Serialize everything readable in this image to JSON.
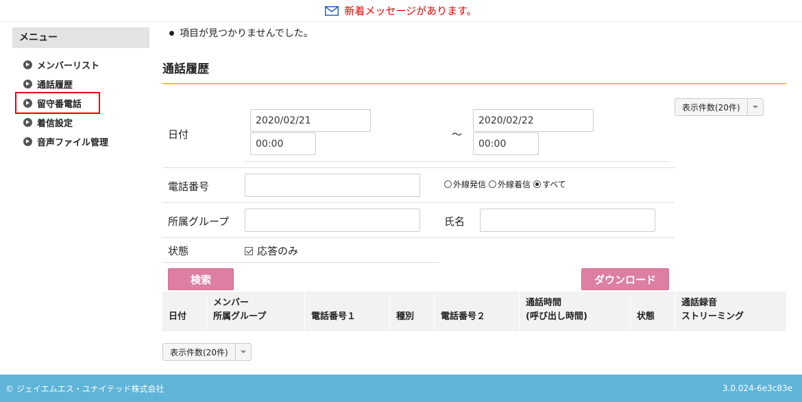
{
  "notice": {
    "text": "新着メッセージがあります。",
    "icon": "mail-icon"
  },
  "sidebar": {
    "header": "メニュー",
    "items": [
      {
        "label": "メンバーリスト"
      },
      {
        "label": "通話履歴"
      },
      {
        "label": "留守番電話"
      },
      {
        "label": "着信設定"
      },
      {
        "label": "音声ファイル管理"
      }
    ]
  },
  "main": {
    "no_items_message": "項目が見つかりませんでした。",
    "title": "通話履歴",
    "page_size_label": "表示件数(20件)",
    "form": {
      "date_label": "日付",
      "date_from": "2020/02/21",
      "time_from": "00:00",
      "range_separator": "～",
      "date_to": "2020/02/22",
      "time_to": "00:00",
      "phone_label": "電話番号",
      "phone_value": "",
      "radio_outgoing": "外線発信",
      "radio_incoming": "外線着信",
      "radio_all": "すべて",
      "group_label": "所属グループ",
      "group_value": "",
      "name_label": "氏名",
      "name_value": "",
      "status_label": "状態",
      "answered_only_label": "応答のみ",
      "search_button": "検索",
      "download_button": "ダウンロード"
    },
    "table_headers": [
      {
        "line1": "",
        "line2": "日付"
      },
      {
        "line1": "メンバー",
        "line2": "所属グループ"
      },
      {
        "line1": "",
        "line2": "電話番号１"
      },
      {
        "line1": "",
        "line2": "種別"
      },
      {
        "line1": "",
        "line2": "電話番号２"
      },
      {
        "line1": "通話時間",
        "line2": "(呼び出し時間)"
      },
      {
        "line1": "",
        "line2": "状態"
      },
      {
        "line1": "通話録音",
        "line2": "ストリーミング"
      }
    ],
    "bottom_page_size_label": "表示件数(20件)"
  },
  "footer": {
    "copyright": "© ジェイエムエス・ユナイテッド株式会社",
    "version": "3.0.024-6e3c83e"
  },
  "colors": {
    "notice_text": "#ee0000",
    "accent_line": "#f0c040",
    "button_pink": "#dc7fa2",
    "footer_bg": "#5fb4d8",
    "highlight_box": "#ee0000"
  }
}
